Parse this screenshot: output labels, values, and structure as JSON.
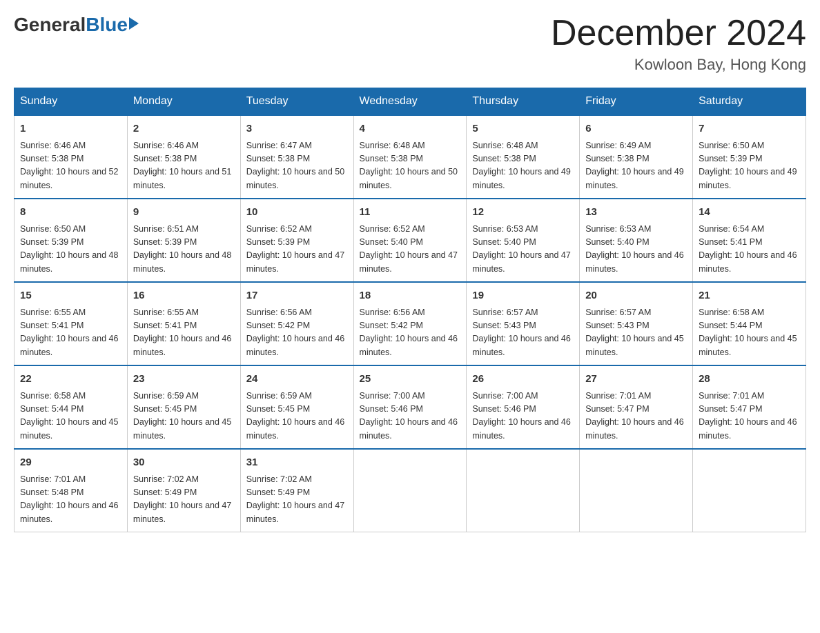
{
  "logo": {
    "general": "General",
    "blue": "Blue"
  },
  "title": "December 2024",
  "location": "Kowloon Bay, Hong Kong",
  "days_header": [
    "Sunday",
    "Monday",
    "Tuesday",
    "Wednesday",
    "Thursday",
    "Friday",
    "Saturday"
  ],
  "weeks": [
    [
      {
        "day": "1",
        "sunrise": "6:46 AM",
        "sunset": "5:38 PM",
        "daylight": "10 hours and 52 minutes."
      },
      {
        "day": "2",
        "sunrise": "6:46 AM",
        "sunset": "5:38 PM",
        "daylight": "10 hours and 51 minutes."
      },
      {
        "day": "3",
        "sunrise": "6:47 AM",
        "sunset": "5:38 PM",
        "daylight": "10 hours and 50 minutes."
      },
      {
        "day": "4",
        "sunrise": "6:48 AM",
        "sunset": "5:38 PM",
        "daylight": "10 hours and 50 minutes."
      },
      {
        "day": "5",
        "sunrise": "6:48 AM",
        "sunset": "5:38 PM",
        "daylight": "10 hours and 49 minutes."
      },
      {
        "day": "6",
        "sunrise": "6:49 AM",
        "sunset": "5:38 PM",
        "daylight": "10 hours and 49 minutes."
      },
      {
        "day": "7",
        "sunrise": "6:50 AM",
        "sunset": "5:39 PM",
        "daylight": "10 hours and 49 minutes."
      }
    ],
    [
      {
        "day": "8",
        "sunrise": "6:50 AM",
        "sunset": "5:39 PM",
        "daylight": "10 hours and 48 minutes."
      },
      {
        "day": "9",
        "sunrise": "6:51 AM",
        "sunset": "5:39 PM",
        "daylight": "10 hours and 48 minutes."
      },
      {
        "day": "10",
        "sunrise": "6:52 AM",
        "sunset": "5:39 PM",
        "daylight": "10 hours and 47 minutes."
      },
      {
        "day": "11",
        "sunrise": "6:52 AM",
        "sunset": "5:40 PM",
        "daylight": "10 hours and 47 minutes."
      },
      {
        "day": "12",
        "sunrise": "6:53 AM",
        "sunset": "5:40 PM",
        "daylight": "10 hours and 47 minutes."
      },
      {
        "day": "13",
        "sunrise": "6:53 AM",
        "sunset": "5:40 PM",
        "daylight": "10 hours and 46 minutes."
      },
      {
        "day": "14",
        "sunrise": "6:54 AM",
        "sunset": "5:41 PM",
        "daylight": "10 hours and 46 minutes."
      }
    ],
    [
      {
        "day": "15",
        "sunrise": "6:55 AM",
        "sunset": "5:41 PM",
        "daylight": "10 hours and 46 minutes."
      },
      {
        "day": "16",
        "sunrise": "6:55 AM",
        "sunset": "5:41 PM",
        "daylight": "10 hours and 46 minutes."
      },
      {
        "day": "17",
        "sunrise": "6:56 AM",
        "sunset": "5:42 PM",
        "daylight": "10 hours and 46 minutes."
      },
      {
        "day": "18",
        "sunrise": "6:56 AM",
        "sunset": "5:42 PM",
        "daylight": "10 hours and 46 minutes."
      },
      {
        "day": "19",
        "sunrise": "6:57 AM",
        "sunset": "5:43 PM",
        "daylight": "10 hours and 46 minutes."
      },
      {
        "day": "20",
        "sunrise": "6:57 AM",
        "sunset": "5:43 PM",
        "daylight": "10 hours and 45 minutes."
      },
      {
        "day": "21",
        "sunrise": "6:58 AM",
        "sunset": "5:44 PM",
        "daylight": "10 hours and 45 minutes."
      }
    ],
    [
      {
        "day": "22",
        "sunrise": "6:58 AM",
        "sunset": "5:44 PM",
        "daylight": "10 hours and 45 minutes."
      },
      {
        "day": "23",
        "sunrise": "6:59 AM",
        "sunset": "5:45 PM",
        "daylight": "10 hours and 45 minutes."
      },
      {
        "day": "24",
        "sunrise": "6:59 AM",
        "sunset": "5:45 PM",
        "daylight": "10 hours and 46 minutes."
      },
      {
        "day": "25",
        "sunrise": "7:00 AM",
        "sunset": "5:46 PM",
        "daylight": "10 hours and 46 minutes."
      },
      {
        "day": "26",
        "sunrise": "7:00 AM",
        "sunset": "5:46 PM",
        "daylight": "10 hours and 46 minutes."
      },
      {
        "day": "27",
        "sunrise": "7:01 AM",
        "sunset": "5:47 PM",
        "daylight": "10 hours and 46 minutes."
      },
      {
        "day": "28",
        "sunrise": "7:01 AM",
        "sunset": "5:47 PM",
        "daylight": "10 hours and 46 minutes."
      }
    ],
    [
      {
        "day": "29",
        "sunrise": "7:01 AM",
        "sunset": "5:48 PM",
        "daylight": "10 hours and 46 minutes."
      },
      {
        "day": "30",
        "sunrise": "7:02 AM",
        "sunset": "5:49 PM",
        "daylight": "10 hours and 47 minutes."
      },
      {
        "day": "31",
        "sunrise": "7:02 AM",
        "sunset": "5:49 PM",
        "daylight": "10 hours and 47 minutes."
      },
      null,
      null,
      null,
      null
    ]
  ]
}
